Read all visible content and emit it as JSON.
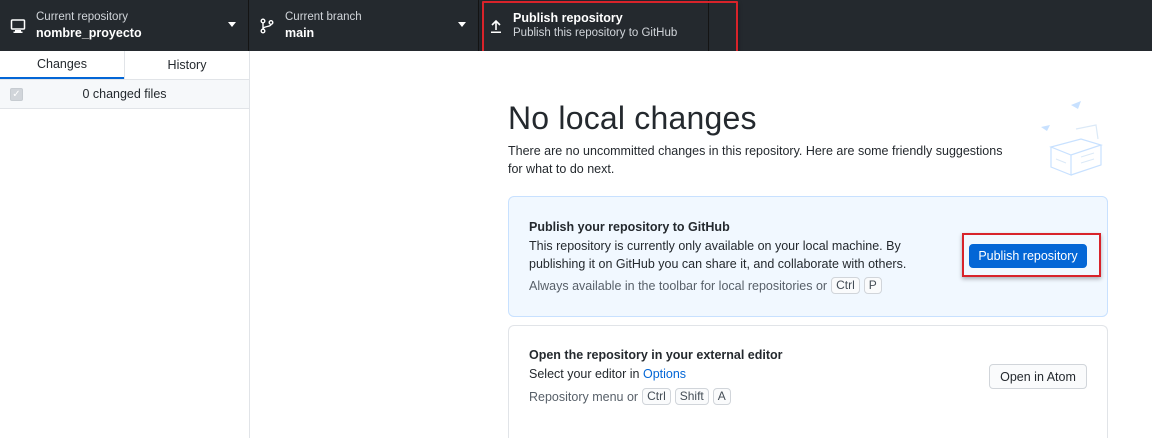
{
  "toolbar": {
    "repository": {
      "label": "Current repository",
      "value": "nombre_proyecto",
      "icon": "computer-icon"
    },
    "branch": {
      "label": "Current branch",
      "value": "main",
      "icon": "branch-icon"
    },
    "publish": {
      "title": "Publish repository",
      "subtitle": "Publish this repository to GitHub",
      "icon": "upload-icon"
    }
  },
  "sidebar": {
    "tabs": [
      {
        "label": "Changes",
        "active": true
      },
      {
        "label": "History",
        "active": false
      }
    ],
    "changed_files": "0 changed files"
  },
  "main": {
    "title": "No local changes",
    "subtitle": "There are no uncommitted changes in this repository. Here are some friendly suggestions for what to do next.",
    "publish_card": {
      "title": "Publish your repository to GitHub",
      "description": "This repository is currently only available on your local machine. By publishing it on GitHub you can share it, and collaborate with others.",
      "hint": "Always available in the toolbar for local repositories or",
      "keys": [
        "Ctrl",
        "P"
      ],
      "button": "Publish repository"
    },
    "editor_card": {
      "title": "Open the repository in your external editor",
      "description_prefix": "Select your editor in",
      "description_link": "Options",
      "hint": "Repository menu or",
      "keys": [
        "Ctrl",
        "Shift",
        "A"
      ],
      "button": "Open in Atom"
    }
  },
  "colors": {
    "toolbar_bg": "#24292e",
    "accent": "#0366d6",
    "highlight": "#d8232a",
    "card_bg": "#f1f8ff"
  }
}
